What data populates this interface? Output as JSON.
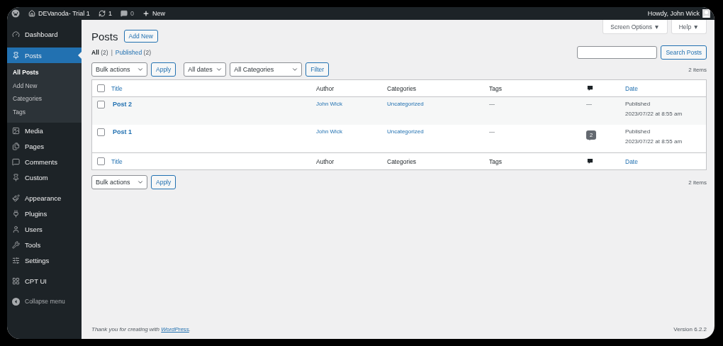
{
  "admin_bar": {
    "site": "DEVanoda- Trial 1",
    "updates": "1",
    "comments": "0",
    "new": "New",
    "greeting": "Howdy, John Wick"
  },
  "sidebar": {
    "groups": [
      [
        {
          "label": "Dashboard",
          "selected": false
        }
      ],
      [
        {
          "label": "Posts",
          "selected": true,
          "children": [
            {
              "label": "All Posts",
              "selected": true
            },
            {
              "label": "Add New",
              "selected": false
            },
            {
              "label": "Categories",
              "selected": false
            },
            {
              "label": "Tags",
              "selected": false
            }
          ]
        },
        {
          "label": "Media",
          "selected": false
        },
        {
          "label": "Pages",
          "selected": false
        },
        {
          "label": "Comments",
          "selected": false
        },
        {
          "label": "Custom",
          "selected": false
        }
      ],
      [
        {
          "label": "Appearance",
          "selected": false
        },
        {
          "label": "Plugins",
          "selected": false
        },
        {
          "label": "Users",
          "selected": false
        },
        {
          "label": "Tools",
          "selected": false
        },
        {
          "label": "Settings",
          "selected": false
        }
      ],
      [
        {
          "label": "CPT UI",
          "selected": false
        }
      ]
    ],
    "collapse": "Collapse menu"
  },
  "screen_tabs": [
    "Screen Options ▼",
    "Help ▼"
  ],
  "page": {
    "title": "Posts",
    "add_new": "Add New"
  },
  "views": [
    {
      "label": "All",
      "count": "(2)",
      "selected": true
    },
    {
      "label": "Published",
      "count": "(2)",
      "selected": false
    }
  ],
  "views_separator": "|",
  "search": {
    "button": "Search Posts"
  },
  "top_nav": {
    "bulk": "Bulk actions",
    "apply": "Apply",
    "dates": "All dates",
    "categories": "All Categories",
    "filter": "Filter",
    "count": "2 items"
  },
  "table": {
    "header": {
      "checked": false,
      "columns": [
        "Title",
        "Author",
        "Categories",
        "Tags",
        "Date"
      ]
    },
    "footer": {
      "checked": false,
      "columns": [
        "Title",
        "Author",
        "Categories",
        "Tags",
        "Date"
      ]
    },
    "rows": [
      {
        "title": "Post 2",
        "author": "John Wick",
        "category": "Uncategorized",
        "tags": "—",
        "comments": {
          "kind": "dash",
          "text": "—"
        },
        "status": "Published",
        "date": "2023/07/22 at 8:55 am",
        "checked": false
      },
      {
        "title": "Post 1",
        "author": "John Wick",
        "category": "Uncategorized",
        "tags": "—",
        "comments": {
          "kind": "bubble",
          "text": "2"
        },
        "status": "Published",
        "date": "2023/07/22 at 8:55 am",
        "checked": false
      }
    ]
  },
  "bottom_nav": {
    "bulk": "Bulk actions",
    "apply": "Apply",
    "count": "2 items"
  },
  "footer": {
    "before": "Thank you for creating with",
    "link": "WordPress",
    "after": ".",
    "version": "Version 6.2.2"
  }
}
